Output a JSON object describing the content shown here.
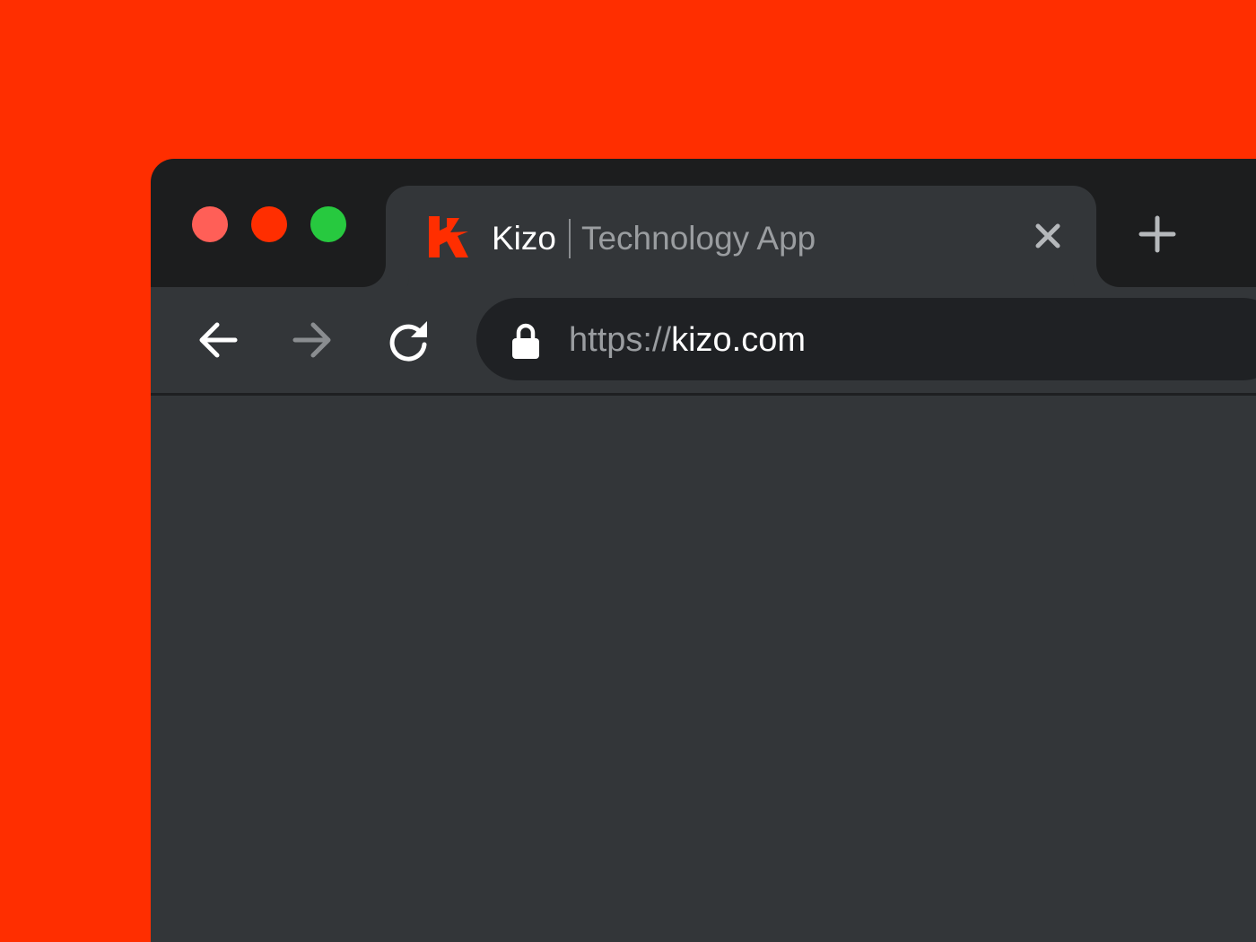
{
  "window": {
    "controls": {
      "close_color": "#ff5f57",
      "minimize_color": "#ff2e00",
      "maximize_color": "#27c93f"
    }
  },
  "tab": {
    "favicon": "kizo-logo-icon",
    "brand": "Kizo",
    "subtitle": "Technology App",
    "close_icon": "close-icon"
  },
  "new_tab_icon": "plus-icon",
  "toolbar": {
    "back_icon": "arrow-left-icon",
    "forward_icon": "arrow-right-icon",
    "reload_icon": "reload-icon"
  },
  "address_bar": {
    "lock_icon": "lock-icon",
    "scheme": "https://",
    "host": "kizo.com"
  },
  "colors": {
    "background": "#ff2e00",
    "accent": "#ff2e00",
    "chrome_dark": "#1c1d1e",
    "chrome_surface": "#333639",
    "omnibox": "#1f2124"
  }
}
